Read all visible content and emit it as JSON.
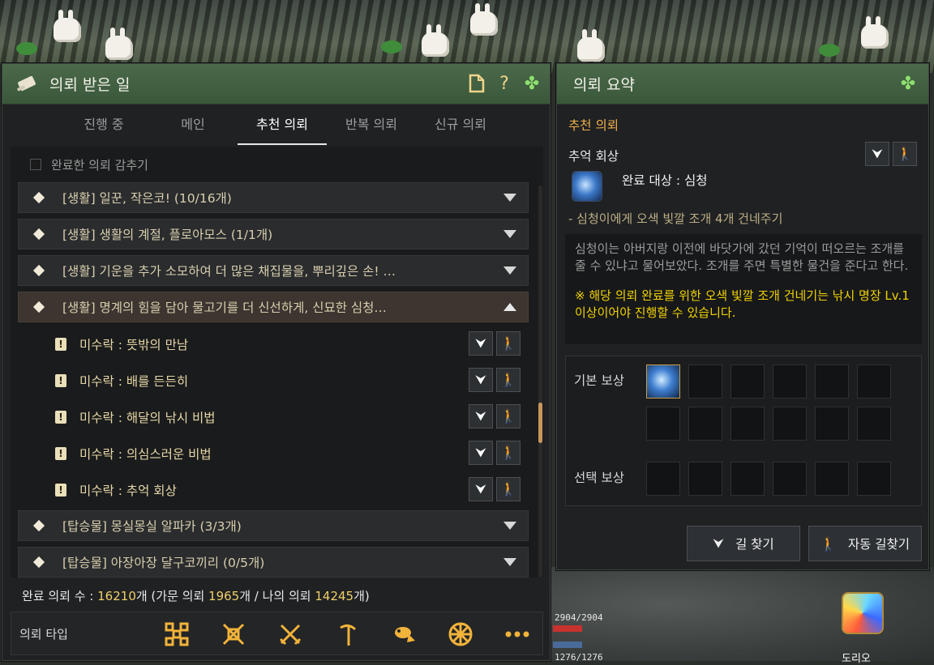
{
  "left_panel": {
    "title": "의뢰 받은 일",
    "icons": {
      "scroll": "scroll-icon",
      "new_doc": "document-icon",
      "help": "question-icon",
      "clover": "clover-icon"
    },
    "help_glyph": "?",
    "tabs": [
      {
        "label": "진행 중",
        "active": false
      },
      {
        "label": "메인",
        "active": false
      },
      {
        "label": "추천 의뢰",
        "active": true
      },
      {
        "label": "반복 의뢰",
        "active": false
      },
      {
        "label": "신규 의뢰",
        "active": false
      }
    ],
    "hide_completed_label": "완료한 의뢰 감추기",
    "quests": [
      {
        "title": "[생활] 일꾼, 작은코! (10/16개)",
        "expanded": false
      },
      {
        "title": "[생활] 생활의 계절, 플로아모스 (1/1개)",
        "expanded": false
      },
      {
        "title": "[생활] 기운을 추가 소모하여 더 많은 채집물을, 뿌리깊은 손! …",
        "expanded": false
      },
      {
        "title": "[생활] 명계의 힘을 담아 물고기를 더 신선하게, 신묘한 심청…",
        "expanded": true
      },
      {
        "title": "[탑승물] 몽실몽실 알파카 (3/3개)",
        "expanded": false
      },
      {
        "title": "[탑승물] 아장아장 달구코끼리 (0/5개)",
        "expanded": false
      }
    ],
    "subquests": [
      {
        "title": "미수락 : 뜻밖의 만남"
      },
      {
        "title": "미수락 : 배를 든든히"
      },
      {
        "title": "미수락 : 해달의 낚시 비법"
      },
      {
        "title": "미수락 : 의심스러운 비법"
      },
      {
        "title": "미수락 : 추억 회상"
      }
    ],
    "sub_icon_glyph": "!",
    "complete": {
      "prefix": "완료 의뢰 수 : ",
      "total": "16210",
      "mid1": "개 (가문 의뢰 ",
      "family": "1965",
      "mid2": "개 / 나의 의뢰 ",
      "mine": "14245",
      "suffix": "개)"
    },
    "type_bar": {
      "label": "의뢰 타입",
      "icons": [
        "grid-icon",
        "scroll-swords-icon",
        "crossed-swords-icon",
        "pickaxe-icon",
        "fish-icon",
        "wheel-icon",
        "more-icon"
      ]
    }
  },
  "right_panel": {
    "title": "의뢰 요약",
    "clover_icon": "clover-icon",
    "section": "추천 의뢰",
    "quest_name": "추억 회상",
    "target": "완료 대상 : 심청",
    "task": "- 심청이에게 오색 빛깔 조개 4개 건네주기",
    "description": "심청이는 아버지랑 이전에 바닷가에 갔던 기억이 떠오르는 조개를 줄 수 있냐고 물어보았다. 조개를 주면 특별한 물건을 준다고 한다.",
    "warning": "※ 해당 의뢰 완료를 위한 오색 빛깔 조개 건네기는 낚시 명장 Lv.1 이상이어야 진행할 수 있습니다.",
    "base_reward_label": "기본 보상",
    "choice_reward_label": "선택 보상",
    "find_path_label": "길 찾기",
    "auto_path_label": "자동 길찾기"
  },
  "hud": {
    "hp": "2904/2904",
    "mp": "1276/1276",
    "pet_name": "도리오"
  },
  "colors": {
    "header_green": "#4b6a4a",
    "accent_gold": "#f0b04a",
    "warning_yellow": "#f1d200",
    "subquest_text": "#e6d8a8"
  }
}
